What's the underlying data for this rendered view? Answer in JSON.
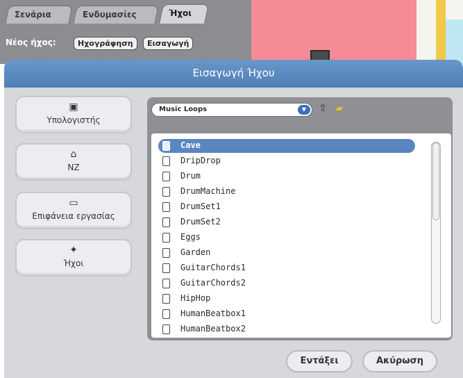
{
  "editor": {
    "tabs": [
      "Σενάρια",
      "Ενδυμασίες",
      "Ήχοι"
    ],
    "active_tab": "Ήχοι",
    "new_sound_label": "Νέος ήχος:",
    "record_button": "Ηχογράφηση",
    "import_button": "Εισαγωγή"
  },
  "dialog": {
    "title": "Εισαγωγή Ήχου",
    "places": [
      {
        "label": "Υπολογιστής",
        "icon": "computer-icon"
      },
      {
        "label": "NZ",
        "icon": "home-icon"
      },
      {
        "label": "Επιφάνεια εργασίας",
        "icon": "folder-icon"
      },
      {
        "label": "Ήχοι",
        "icon": "sounds-folder-icon"
      }
    ],
    "folder_selected": "Music Loops",
    "files": [
      "Cave",
      "DripDrop",
      "Drum",
      "DrumMachine",
      "DrumSet1",
      "DrumSet2",
      "Eggs",
      "Garden",
      "GuitarChords1",
      "GuitarChords2",
      "HipHop",
      "HumanBeatbox1",
      "HumanBeatbox2"
    ],
    "selected_file": "Cave",
    "ok_button": "Εντάξει",
    "cancel_button": "Ακύρωση"
  },
  "colors": {
    "title_bar": "#5f8ec4",
    "selected_row": "#5a86c0",
    "dialog_bg": "#d6d8db",
    "stage_pink": "#f48b96"
  }
}
